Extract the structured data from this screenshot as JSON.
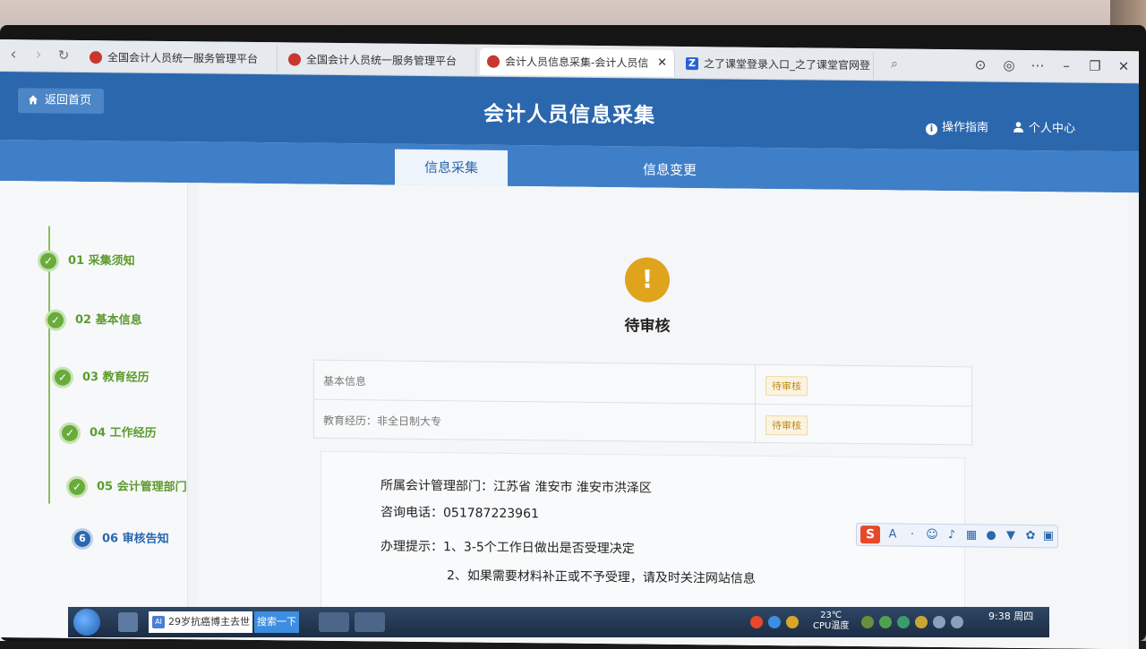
{
  "browser": {
    "tabs": [
      {
        "label": "全国会计人员统一服务管理平台",
        "active": false
      },
      {
        "label": "全国会计人员统一服务管理平台",
        "active": false
      },
      {
        "label": "会计人员信息采集-会计人员信",
        "active": true
      },
      {
        "label": "之了课堂登录入口_之了课堂官网登",
        "active": false
      }
    ],
    "tab_favicon_letter": "Z"
  },
  "header": {
    "home_label": "返回首页",
    "title": "会计人员信息采集",
    "guide_label": "操作指南",
    "user_label": "个人中心"
  },
  "subnav": {
    "tabs": [
      {
        "label": "信息采集",
        "active": true
      },
      {
        "label": "信息变更",
        "active": false
      }
    ]
  },
  "steps": [
    {
      "label": "01 采集须知",
      "done": true
    },
    {
      "label": "02 基本信息",
      "done": true
    },
    {
      "label": "03 教育经历",
      "done": true
    },
    {
      "label": "04 工作经历",
      "done": true
    },
    {
      "label": "05 会计管理部门",
      "done": true
    },
    {
      "label": "06 审核告知",
      "done": false,
      "number": "6"
    }
  ],
  "status": {
    "icon_glyph": "!",
    "text": "待审核",
    "color": "#e0a31c"
  },
  "review_items": [
    {
      "label": "基本信息",
      "status": "待审核"
    },
    {
      "label": "教育经历：非全日制大专",
      "status": "待审核"
    }
  ],
  "notice": {
    "department": "所属会计管理部门：江苏省 淮安市 淮安市洪泽区",
    "phone": "咨询电话：051787223961",
    "tip1": "办理提示：1、3-5个工作日做出是否受理决定",
    "tip2": "2、如果需要材料补正或不予受理，请及时关注网站信息"
  },
  "ime": {
    "logo": "S",
    "letter": "A"
  },
  "taskbar": {
    "search_text": "29岁抗癌博主去世",
    "search_button": "搜索一下",
    "temperature": "23℃",
    "temp_sub": "CPU温度",
    "time": "9:38 周四"
  },
  "colors": {
    "header_blue": "#2b67ad",
    "subnav_blue": "#3f7fc7",
    "step_green": "#6aac3c",
    "pending_orange": "#e0a31c"
  }
}
